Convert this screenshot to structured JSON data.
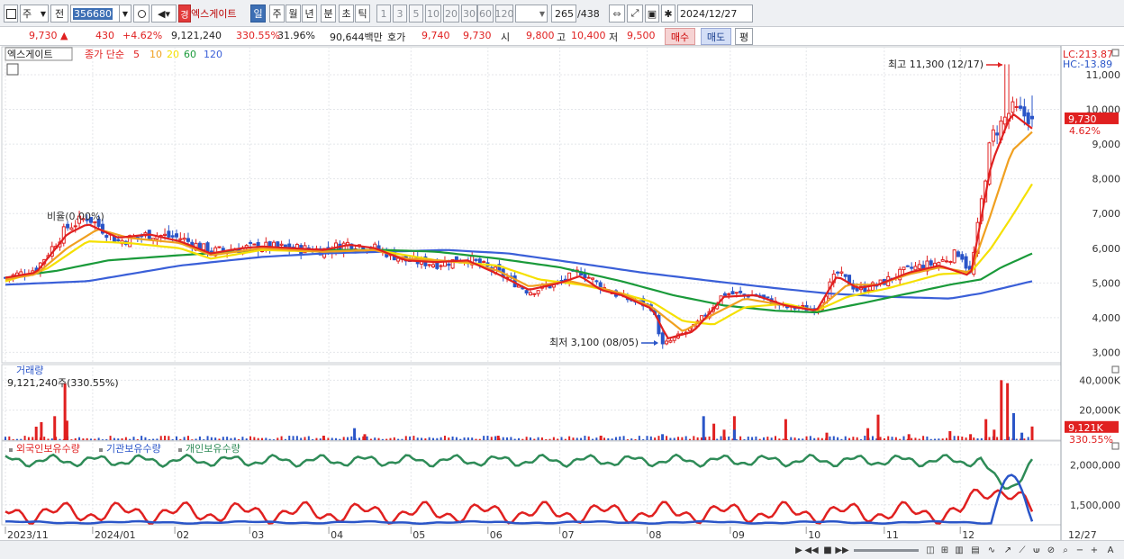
{
  "toolbar": {
    "type_label": "주",
    "prev_label": "전",
    "code": "356680",
    "stock_badge": "경",
    "stock_name": "엑스게이트",
    "periods": [
      "일",
      "주",
      "월",
      "년",
      "분",
      "초",
      "틱"
    ],
    "active_period": "일",
    "intervals": [
      "1",
      "3",
      "5",
      "10",
      "20",
      "30",
      "60",
      "120"
    ],
    "count": "265",
    "total": "/438",
    "date": "2024/12/27"
  },
  "quote": {
    "price": "9,730",
    "arrow": "▲",
    "change": "430",
    "change_pct": "+4.62%",
    "volume": "9,121,240",
    "volume_ratio": "330.55%",
    "turnover": "31.96%",
    "trade_value": "90,644백만",
    "bid_label": "호가",
    "bid1": "9,740",
    "bid2": "9,730",
    "open_label": "시",
    "open": "9,800",
    "high_label": "고",
    "high": "10,400",
    "low_label": "저",
    "low": "9,500",
    "buy_label": "매수",
    "sell_label": "매도",
    "eval_label": "평"
  },
  "legend": {
    "name": "엑스게이트",
    "ma_prefix": "종가 단순",
    "ma": [
      {
        "period": "5",
        "color": "#e02020"
      },
      {
        "period": "10",
        "color": "#f0a020"
      },
      {
        "period": "20",
        "color": "#f5e000"
      },
      {
        "period": "60",
        "color": "#1a9a3a"
      },
      {
        "period": "120",
        "color": "#3a5fd8"
      }
    ]
  },
  "annotations": {
    "lc": "LC:213.87",
    "hc": "HC:-13.89",
    "high_note": "최고 11,300 (12/17)",
    "low_note": "최저 3,100 (08/05)",
    "ratio_note": "비율(0.00%)",
    "price_tag": "9,730",
    "pct_tag": "4.62%",
    "vol_title": "거래량",
    "vol_desc": "9,121,240주(330.55%)",
    "vol_tag": "9,121K",
    "vol_pct_tag": "330.55%",
    "end_date": "12/27"
  },
  "colors": {
    "up": "#e02020",
    "down": "#2a55c8",
    "ma5": "#e02020",
    "ma10": "#f0a020",
    "ma20": "#f5e000",
    "ma60": "#1a9a3a",
    "ma120": "#3a5fd8",
    "foreign": "#e02020",
    "institution": "#2a55c8",
    "individual": "#2e8b57"
  },
  "chart_data": [
    {
      "type": "candlestick",
      "title": "엑스게이트",
      "ylim": [
        2700,
        11700
      ],
      "y_ticks": [
        "3,000",
        "4,000",
        "5,000",
        "6,000",
        "7,000",
        "8,000",
        "9,000",
        "10,000",
        "11,000"
      ],
      "y_tick_values": [
        3000,
        4000,
        5000,
        6000,
        7000,
        8000,
        9000,
        10000,
        11000
      ],
      "x_ticks": [
        "2023/11",
        "2024/01",
        "02",
        "03",
        "04",
        "05",
        "06",
        "07",
        "08",
        "09",
        "10",
        "11",
        "12"
      ],
      "close_anchors": [
        [
          0,
          5150
        ],
        [
          0.03,
          5400
        ],
        [
          0.06,
          6600
        ],
        [
          0.08,
          6900
        ],
        [
          0.11,
          6200
        ],
        [
          0.14,
          6400
        ],
        [
          0.17,
          6300
        ],
        [
          0.2,
          5900
        ],
        [
          0.23,
          6000
        ],
        [
          0.25,
          6050
        ],
        [
          0.28,
          6000
        ],
        [
          0.31,
          5950
        ],
        [
          0.335,
          6150
        ],
        [
          0.36,
          6000
        ],
        [
          0.39,
          5650
        ],
        [
          0.42,
          5550
        ],
        [
          0.45,
          5700
        ],
        [
          0.48,
          5300
        ],
        [
          0.51,
          4750
        ],
        [
          0.54,
          5000
        ],
        [
          0.56,
          5350
        ],
        [
          0.58,
          4900
        ],
        [
          0.6,
          4600
        ],
        [
          0.63,
          4300
        ],
        [
          0.64,
          3200
        ],
        [
          0.67,
          3700
        ],
        [
          0.7,
          4700
        ],
        [
          0.73,
          4650
        ],
        [
          0.76,
          4300
        ],
        [
          0.79,
          4250
        ],
        [
          0.81,
          5300
        ],
        [
          0.83,
          4800
        ],
        [
          0.85,
          4950
        ],
        [
          0.88,
          5400
        ],
        [
          0.91,
          5600
        ],
        [
          0.93,
          5900
        ],
        [
          0.94,
          5200
        ],
        [
          0.96,
          9200
        ],
        [
          0.98,
          10000
        ],
        [
          1.0,
          9730
        ]
      ],
      "ma_anchors": {
        "5": [
          [
            0,
            5150
          ],
          [
            0.03,
            5300
          ],
          [
            0.06,
            6400
          ],
          [
            0.08,
            6700
          ],
          [
            0.11,
            6300
          ],
          [
            0.14,
            6400
          ],
          [
            0.17,
            6200
          ],
          [
            0.2,
            5850
          ],
          [
            0.23,
            6000
          ],
          [
            0.25,
            6050
          ],
          [
            0.28,
            6000
          ],
          [
            0.31,
            5950
          ],
          [
            0.335,
            6100
          ],
          [
            0.36,
            6000
          ],
          [
            0.39,
            5650
          ],
          [
            0.42,
            5600
          ],
          [
            0.45,
            5650
          ],
          [
            0.48,
            5250
          ],
          [
            0.51,
            4800
          ],
          [
            0.54,
            5000
          ],
          [
            0.56,
            5200
          ],
          [
            0.58,
            4800
          ],
          [
            0.6,
            4650
          ],
          [
            0.63,
            4250
          ],
          [
            0.645,
            3400
          ],
          [
            0.67,
            3600
          ],
          [
            0.7,
            4600
          ],
          [
            0.73,
            4650
          ],
          [
            0.76,
            4350
          ],
          [
            0.79,
            4200
          ],
          [
            0.81,
            5200
          ],
          [
            0.83,
            4850
          ],
          [
            0.85,
            4950
          ],
          [
            0.88,
            5300
          ],
          [
            0.91,
            5500
          ],
          [
            0.94,
            5200
          ],
          [
            0.96,
            8400
          ],
          [
            0.98,
            9900
          ],
          [
            1.0,
            9450
          ]
        ],
        "10": [
          [
            0,
            5100
          ],
          [
            0.03,
            5250
          ],
          [
            0.06,
            6000
          ],
          [
            0.09,
            6550
          ],
          [
            0.12,
            6300
          ],
          [
            0.17,
            6150
          ],
          [
            0.2,
            5800
          ],
          [
            0.25,
            6000
          ],
          [
            0.31,
            5900
          ],
          [
            0.36,
            5950
          ],
          [
            0.39,
            5700
          ],
          [
            0.45,
            5600
          ],
          [
            0.48,
            5350
          ],
          [
            0.51,
            4900
          ],
          [
            0.55,
            5050
          ],
          [
            0.58,
            4850
          ],
          [
            0.6,
            4700
          ],
          [
            0.63,
            4300
          ],
          [
            0.66,
            3600
          ],
          [
            0.69,
            4100
          ],
          [
            0.72,
            4550
          ],
          [
            0.76,
            4350
          ],
          [
            0.79,
            4200
          ],
          [
            0.82,
            4950
          ],
          [
            0.85,
            4950
          ],
          [
            0.88,
            5250
          ],
          [
            0.91,
            5450
          ],
          [
            0.94,
            5300
          ],
          [
            0.96,
            7000
          ],
          [
            0.98,
            8800
          ],
          [
            1.0,
            9350
          ]
        ],
        "20": [
          [
            0,
            5050
          ],
          [
            0.04,
            5400
          ],
          [
            0.08,
            6200
          ],
          [
            0.12,
            6150
          ],
          [
            0.17,
            6000
          ],
          [
            0.2,
            5700
          ],
          [
            0.25,
            5950
          ],
          [
            0.31,
            5900
          ],
          [
            0.36,
            5950
          ],
          [
            0.42,
            5650
          ],
          [
            0.48,
            5500
          ],
          [
            0.52,
            5100
          ],
          [
            0.56,
            4950
          ],
          [
            0.6,
            4700
          ],
          [
            0.63,
            4450
          ],
          [
            0.66,
            3900
          ],
          [
            0.69,
            3800
          ],
          [
            0.72,
            4300
          ],
          [
            0.76,
            4400
          ],
          [
            0.79,
            4200
          ],
          [
            0.82,
            4600
          ],
          [
            0.86,
            4850
          ],
          [
            0.91,
            5250
          ],
          [
            0.94,
            5300
          ],
          [
            0.96,
            6000
          ],
          [
            0.98,
            6900
          ],
          [
            1.0,
            7850
          ]
        ],
        "60": [
          [
            0,
            5150
          ],
          [
            0.05,
            5350
          ],
          [
            0.1,
            5650
          ],
          [
            0.17,
            5800
          ],
          [
            0.25,
            5950
          ],
          [
            0.31,
            5950
          ],
          [
            0.37,
            5950
          ],
          [
            0.42,
            5900
          ],
          [
            0.48,
            5700
          ],
          [
            0.54,
            5450
          ],
          [
            0.6,
            5050
          ],
          [
            0.65,
            4650
          ],
          [
            0.7,
            4350
          ],
          [
            0.75,
            4200
          ],
          [
            0.79,
            4150
          ],
          [
            0.84,
            4450
          ],
          [
            0.88,
            4700
          ],
          [
            0.92,
            4950
          ],
          [
            0.95,
            5100
          ],
          [
            0.97,
            5450
          ],
          [
            1.0,
            5850
          ]
        ],
        "120": [
          [
            0,
            4950
          ],
          [
            0.08,
            5050
          ],
          [
            0.17,
            5500
          ],
          [
            0.25,
            5750
          ],
          [
            0.31,
            5850
          ],
          [
            0.37,
            5900
          ],
          [
            0.43,
            5950
          ],
          [
            0.49,
            5850
          ],
          [
            0.55,
            5600
          ],
          [
            0.62,
            5300
          ],
          [
            0.69,
            5050
          ],
          [
            0.75,
            4850
          ],
          [
            0.8,
            4700
          ],
          [
            0.86,
            4600
          ],
          [
            0.92,
            4550
          ],
          [
            0.95,
            4700
          ],
          [
            1.0,
            5050
          ]
        ]
      }
    },
    {
      "type": "bar",
      "title": "거래량",
      "ylim": [
        0,
        48000
      ],
      "y_ticks": [
        "20,000K",
        "40,000K"
      ],
      "y_tick_values": [
        20000,
        40000
      ],
      "spikes": [
        [
          0.03,
          9000,
          "up"
        ],
        [
          0.035,
          12000,
          "up"
        ],
        [
          0.048,
          16000,
          "up"
        ],
        [
          0.058,
          38000,
          "up"
        ],
        [
          0.06,
          13000,
          "up"
        ],
        [
          0.31,
          3000,
          "up"
        ],
        [
          0.34,
          8000,
          "down"
        ],
        [
          0.35,
          4000,
          "up"
        ],
        [
          0.48,
          3000,
          "up"
        ],
        [
          0.58,
          3000,
          "up"
        ],
        [
          0.64,
          4000,
          "down"
        ],
        [
          0.68,
          16000,
          "down"
        ],
        [
          0.69,
          11000,
          "up"
        ],
        [
          0.7,
          7000,
          "up"
        ],
        [
          0.71,
          16000,
          "up"
        ],
        [
          0.71,
          7000,
          "down"
        ],
        [
          0.76,
          14000,
          "up"
        ],
        [
          0.8,
          5000,
          "up"
        ],
        [
          0.84,
          8000,
          "up"
        ],
        [
          0.85,
          17000,
          "up"
        ],
        [
          0.88,
          4000,
          "up"
        ],
        [
          0.92,
          6000,
          "up"
        ],
        [
          0.94,
          4000,
          "up"
        ],
        [
          0.955,
          14000,
          "up"
        ],
        [
          0.963,
          7000,
          "up"
        ],
        [
          0.97,
          40000,
          "up"
        ],
        [
          0.976,
          38000,
          "up"
        ],
        [
          0.982,
          18000,
          "down"
        ],
        [
          0.99,
          5000,
          "down"
        ],
        [
          1.0,
          9121,
          "up"
        ]
      ],
      "last_value": 9121
    },
    {
      "type": "line",
      "title": "외국인보유수량 · 기관보유수량 · 개인보유수량",
      "series": [
        {
          "name": "외국인보유수량",
          "color": "#e02020"
        },
        {
          "name": "기관보유수량",
          "color": "#2a55c8"
        },
        {
          "name": "개인보유수량",
          "color": "#2e8b57"
        }
      ],
      "ylim": [
        1250000,
        2250000
      ],
      "y_ticks": [
        "1,500,000",
        "2,000,000"
      ],
      "y_tick_values": [
        1500000,
        2000000
      ]
    }
  ]
}
